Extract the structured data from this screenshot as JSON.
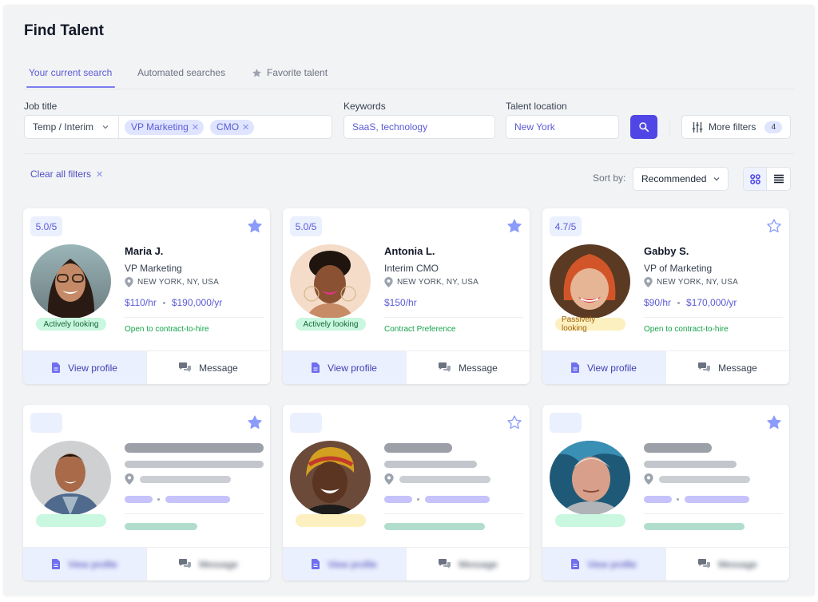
{
  "page": {
    "title": "Find Talent"
  },
  "tabs": [
    {
      "label": "Your current search",
      "active": true
    },
    {
      "label": "Automated searches",
      "active": false
    },
    {
      "label": "Favorite talent",
      "active": false,
      "icon": "star-icon"
    }
  ],
  "filters": {
    "job_title_label": "Job title",
    "job_type_selected": "Temp / Interim",
    "job_title_chips": [
      "VP Marketing",
      "CMO"
    ],
    "keywords_label": "Keywords",
    "keywords_value": "SaaS, technology",
    "location_label": "Talent location",
    "location_value": "New York",
    "more_filters_label": "More filters",
    "more_filters_count": "4",
    "clear_all_label": "Clear all filters"
  },
  "sort": {
    "label": "Sort by:",
    "selected": "Recommended"
  },
  "view": {
    "active": "grid"
  },
  "actions": {
    "view_profile": "View profile",
    "message": "Message"
  },
  "candidates": [
    {
      "rating": "5.0/5",
      "favorited": true,
      "name": "Maria J.",
      "role": "VP Marketing",
      "location": "NEW YORK, NY, USA",
      "hourly": "$110/hr",
      "annual": "$190,000/yr",
      "preference": "Open to contract-to-hire",
      "status": "Actively looking",
      "status_type": "active"
    },
    {
      "rating": "5.0/5",
      "favorited": true,
      "name": "Antonia L.",
      "role": "Interim CMO",
      "location": "NEW YORK, NY, USA",
      "hourly": "$150/hr",
      "annual": "",
      "preference": "Contract Preference",
      "status": "Actively looking",
      "status_type": "active"
    },
    {
      "rating": "4.7/5",
      "favorited": false,
      "name": "Gabby S.",
      "role": "VP of Marketing",
      "location": "NEW YORK, NY, USA",
      "hourly": "$90/hr",
      "annual": "$170,000/yr",
      "preference": "Open to contract-to-hire",
      "status": "Passively looking",
      "status_type": "passive"
    }
  ],
  "placeholder_cards": [
    {
      "favorited": true,
      "status_type": "active"
    },
    {
      "favorited": false,
      "status_type": "passive"
    },
    {
      "favorited": true,
      "status_type": "active"
    }
  ],
  "colors": {
    "accent": "#5046e5",
    "accent_text": "#5b5bd6",
    "active_status_bg": "#c9f7e0",
    "passive_status_bg": "#fdf0c0",
    "preference_green": "#16a34a",
    "panel_bg": "#f2f3f5"
  }
}
